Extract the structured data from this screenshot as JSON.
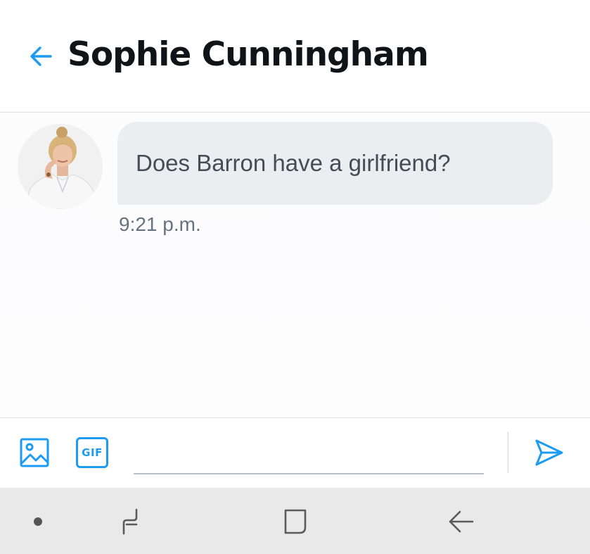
{
  "header": {
    "title": "Sophie Cunningham",
    "back_icon": "arrow-left-icon"
  },
  "conversation": {
    "messages": [
      {
        "sender": "Sophie Cunningham",
        "avatar_icon": "avatar-photo",
        "text": "Does Barron have a girlfriend?",
        "time": "9:21 p.m."
      }
    ]
  },
  "composer": {
    "media_icon": "image-icon",
    "gif_label": "GIF",
    "input_value": "",
    "input_placeholder": "",
    "send_icon": "send-icon"
  },
  "navbar": {
    "items": [
      "dot-icon",
      "recents-icon",
      "home-icon",
      "back-icon"
    ]
  },
  "colors": {
    "accent": "#1d9bf0",
    "bubble": "#ebeef1",
    "title_text": "#0f1419",
    "timestamp": "#66727f",
    "navbar": "#e9e9e9"
  }
}
